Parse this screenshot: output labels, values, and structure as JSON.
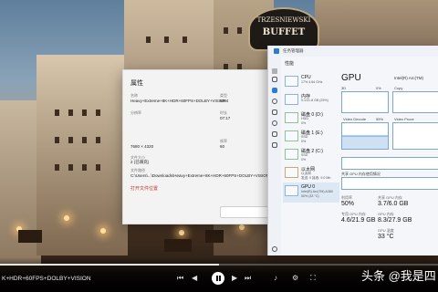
{
  "properties_dialog": {
    "title": "属性",
    "name_label": "名称",
    "name_value": "Heavy+Extreme+8K+HDR+60FPS+DOLBY+VISION",
    "type_label": "类型",
    "type_value": "MP4",
    "resolution_label": "分辨率",
    "resolution_value": "7680 × 4320",
    "duration_label": "时长",
    "duration_value": "07:17",
    "framerate_label": "帧率",
    "framerate_value": "60",
    "size_label": "文件大小",
    "size_value": "2 (已填充)",
    "path_label": "文件路径",
    "path_value": "C:\\Users\\...\\Downloads\\Heavy+Extreme+8K+HDR+60FPS+DOLBY+VISION",
    "open_location_link": "打开文件位置"
  },
  "task_manager": {
    "app_title": "任务管理器",
    "section_title": "性能",
    "resources": [
      {
        "name": "CPU",
        "sub": "17% 4.64 GHz",
        "sub2": ""
      },
      {
        "name": "内存",
        "sub": "9.1/31.8 GB (29%)",
        "sub2": ""
      },
      {
        "name": "磁盘 0 (D:)",
        "sub": "HDD",
        "sub2": "0%"
      },
      {
        "name": "磁盘 1 (E:)",
        "sub": "SSD",
        "sub2": "0%"
      },
      {
        "name": "磁盘 2 (C:)",
        "sub": "SSD",
        "sub2": "0%"
      },
      {
        "name": "以太网",
        "sub": "以太网",
        "sub2": "发送: 0 接收: 9.0 Mb"
      },
      {
        "name": "GPU 0",
        "sub": "Intel(R) Arc(TM) A380",
        "sub2": "50% (33 °C)"
      }
    ],
    "gpu": {
      "title": "GPU",
      "model": "Intel(R) Arc(TM)",
      "graph1_label": "3D",
      "graph1_pct": "0%",
      "graph1_right": "Copy",
      "graph2_label": "Video Decode",
      "graph2_pct": "55%",
      "graph2_right": "Video Proce",
      "shared_label": "共享 GPU 内存使用情况",
      "util_label": "利用率",
      "util_value": "50%",
      "shared_mem_label": "共享 GPU 内存",
      "shared_mem_value": "3.7/6.0 GB",
      "dedicated_label": "专用 GPU 内存",
      "dedicated_value": "4.6/21.9 GB",
      "gpu_mem_label": "GPU 内存",
      "gpu_mem_value": "8.3/27.9 GB",
      "temp_label": "GPU 温度",
      "temp_value": "33 °C"
    }
  },
  "player": {
    "file_title": "K+HDR+60FPS+DOLBY+VISION",
    "progress_fraction": 0.5
  },
  "background": {
    "sign_line1": "TRZESNIEWSKI",
    "sign_line2": "BUFFET"
  },
  "watermark": "头条 @我是四"
}
